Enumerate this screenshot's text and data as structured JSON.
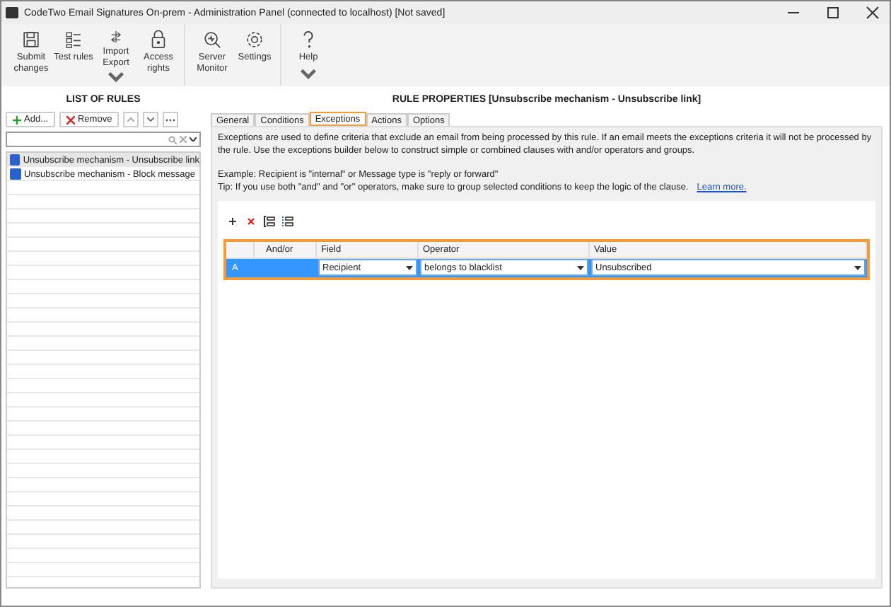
{
  "window": {
    "title": "CodeTwo Email Signatures On-prem - Administration Panel (connected to localhost) [Not saved]"
  },
  "toolbar": {
    "groups": [
      [
        {
          "kind": "save",
          "label": "Submit changes",
          "dropdown": false
        },
        {
          "kind": "checklist",
          "label": "Test rules",
          "dropdown": false
        },
        {
          "kind": "transfer",
          "label": "Import Export",
          "dropdown": true
        },
        {
          "kind": "lock",
          "label": "Access rights",
          "dropdown": false
        }
      ],
      [
        {
          "kind": "monitor",
          "label": "Server Monitor",
          "dropdown": false
        },
        {
          "kind": "gear",
          "label": "Settings",
          "dropdown": false
        }
      ],
      [
        {
          "kind": "help",
          "label": "Help",
          "dropdown": true
        }
      ]
    ]
  },
  "rules_panel": {
    "title": "LIST OF RULES",
    "add_button": "Add...",
    "remove_button": "Remove",
    "rules": [
      {
        "name": "Unsubscribe mechanism - Unsubscribe link",
        "checked": true,
        "selected": true
      },
      {
        "name": "Unsubscribe mechanism - Block message",
        "checked": true,
        "selected": false
      }
    ]
  },
  "properties": {
    "title": "RULE PROPERTIES [Unsubscribe mechanism - Unsubscribe link]",
    "tabs": [
      {
        "label": "General",
        "selected": false
      },
      {
        "label": "Conditions",
        "selected": false
      },
      {
        "label": "Exceptions",
        "selected": true
      },
      {
        "label": "Actions",
        "selected": false
      },
      {
        "label": "Options",
        "selected": false
      }
    ],
    "description": "Exceptions are used to define criteria that exclude an email from being processed by this rule. If an email meets the exceptions criteria it will not be processed by the rule. Use the exceptions builder below to construct simple or combined clauses with and/or operators and groups.",
    "example": "Example: Recipient is \"internal\" or Message type is \"reply or forward\"",
    "tip": "Tip: If you use both \"and\" and \"or\" operators, make sure to group selected conditions to keep the logic of the clause.",
    "learn_more": "Learn more.",
    "table": {
      "columns": [
        "And/or",
        "Field",
        "Operator",
        "Value"
      ],
      "rows": [
        {
          "label": "A",
          "field": "Recipient",
          "operator": "belongs to blacklist",
          "value": "Unsubscribed",
          "selected": true
        }
      ]
    }
  }
}
